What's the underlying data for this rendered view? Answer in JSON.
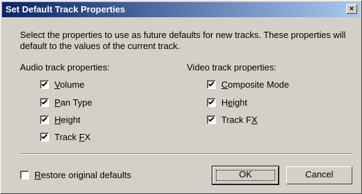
{
  "window": {
    "title": "Set Default Track Properties",
    "close_label": "×"
  },
  "description": "Select the properties to use as future defaults for new tracks. These properties will default to the values of the current track.",
  "audio": {
    "heading": "Audio track properties:",
    "items": [
      {
        "pre": "",
        "key": "V",
        "post": "olume",
        "checked": true
      },
      {
        "pre": "",
        "key": "P",
        "post": "an Type",
        "checked": true
      },
      {
        "pre": "",
        "key": "H",
        "post": "eight",
        "checked": true
      },
      {
        "pre": "Track ",
        "key": "F",
        "post": "X",
        "checked": true
      }
    ]
  },
  "video": {
    "heading": "Video track properties:",
    "items": [
      {
        "pre": "",
        "key": "C",
        "post": "omposite Mode",
        "checked": true
      },
      {
        "pre": "H",
        "key": "e",
        "post": "ight",
        "checked": true
      },
      {
        "pre": "Track F",
        "key": "X",
        "post": "",
        "checked": true
      }
    ]
  },
  "restore": {
    "pre": "",
    "key": "R",
    "post": "estore original defaults",
    "checked": false
  },
  "buttons": {
    "ok": "OK",
    "cancel": "Cancel"
  }
}
